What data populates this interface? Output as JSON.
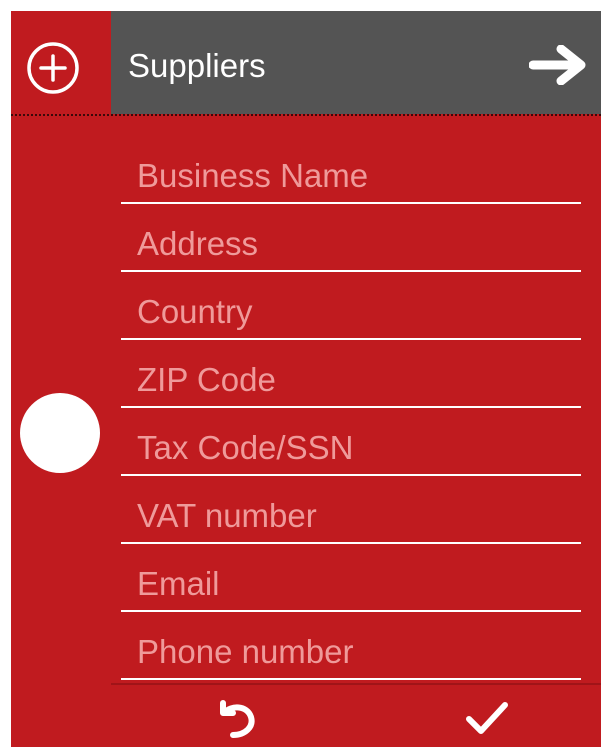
{
  "header": {
    "title": "Suppliers",
    "add_icon": "plus-circle-icon",
    "next_icon": "arrow-right-icon"
  },
  "form": {
    "fields": [
      {
        "placeholder": "Business Name"
      },
      {
        "placeholder": "Address"
      },
      {
        "placeholder": "Country"
      },
      {
        "placeholder": "ZIP Code"
      },
      {
        "placeholder": "Tax Code/SSN"
      },
      {
        "placeholder": "VAT number"
      },
      {
        "placeholder": "Email"
      },
      {
        "placeholder": "Phone number"
      }
    ]
  },
  "footer": {
    "undo_icon": "undo-icon",
    "confirm_icon": "checkmark-icon"
  },
  "colors": {
    "panel_background": "#c01b1f",
    "header_background": "#545454",
    "placeholder_text": "#ef9a9a",
    "foreground": "#ffffff"
  }
}
